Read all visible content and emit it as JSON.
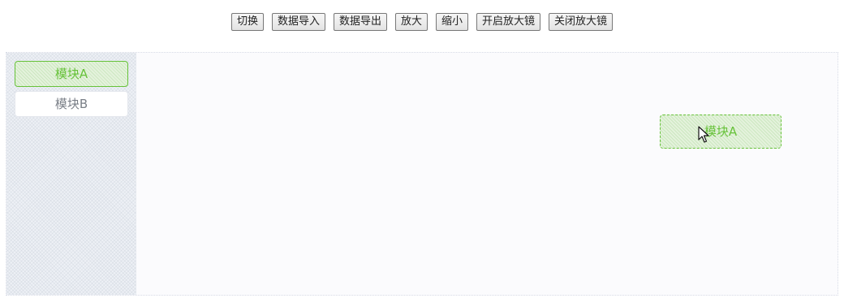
{
  "toolbar": {
    "buttons": [
      {
        "label": "切换"
      },
      {
        "label": "数据导入"
      },
      {
        "label": "数据导出"
      },
      {
        "label": "放大"
      },
      {
        "label": "缩小"
      },
      {
        "label": "开启放大镜"
      },
      {
        "label": "关闭放大镜"
      }
    ]
  },
  "palette": {
    "items": [
      {
        "label": "模块A"
      },
      {
        "label": "模块B"
      }
    ]
  },
  "canvas": {
    "nodes": [
      {
        "label": "模块A"
      }
    ],
    "cursor_icon": "arrow-cursor-icon"
  },
  "colors": {
    "accent_green": "#67c23a",
    "palette_bg": "#eef1f6",
    "canvas_bg": "#fbfbfd"
  }
}
